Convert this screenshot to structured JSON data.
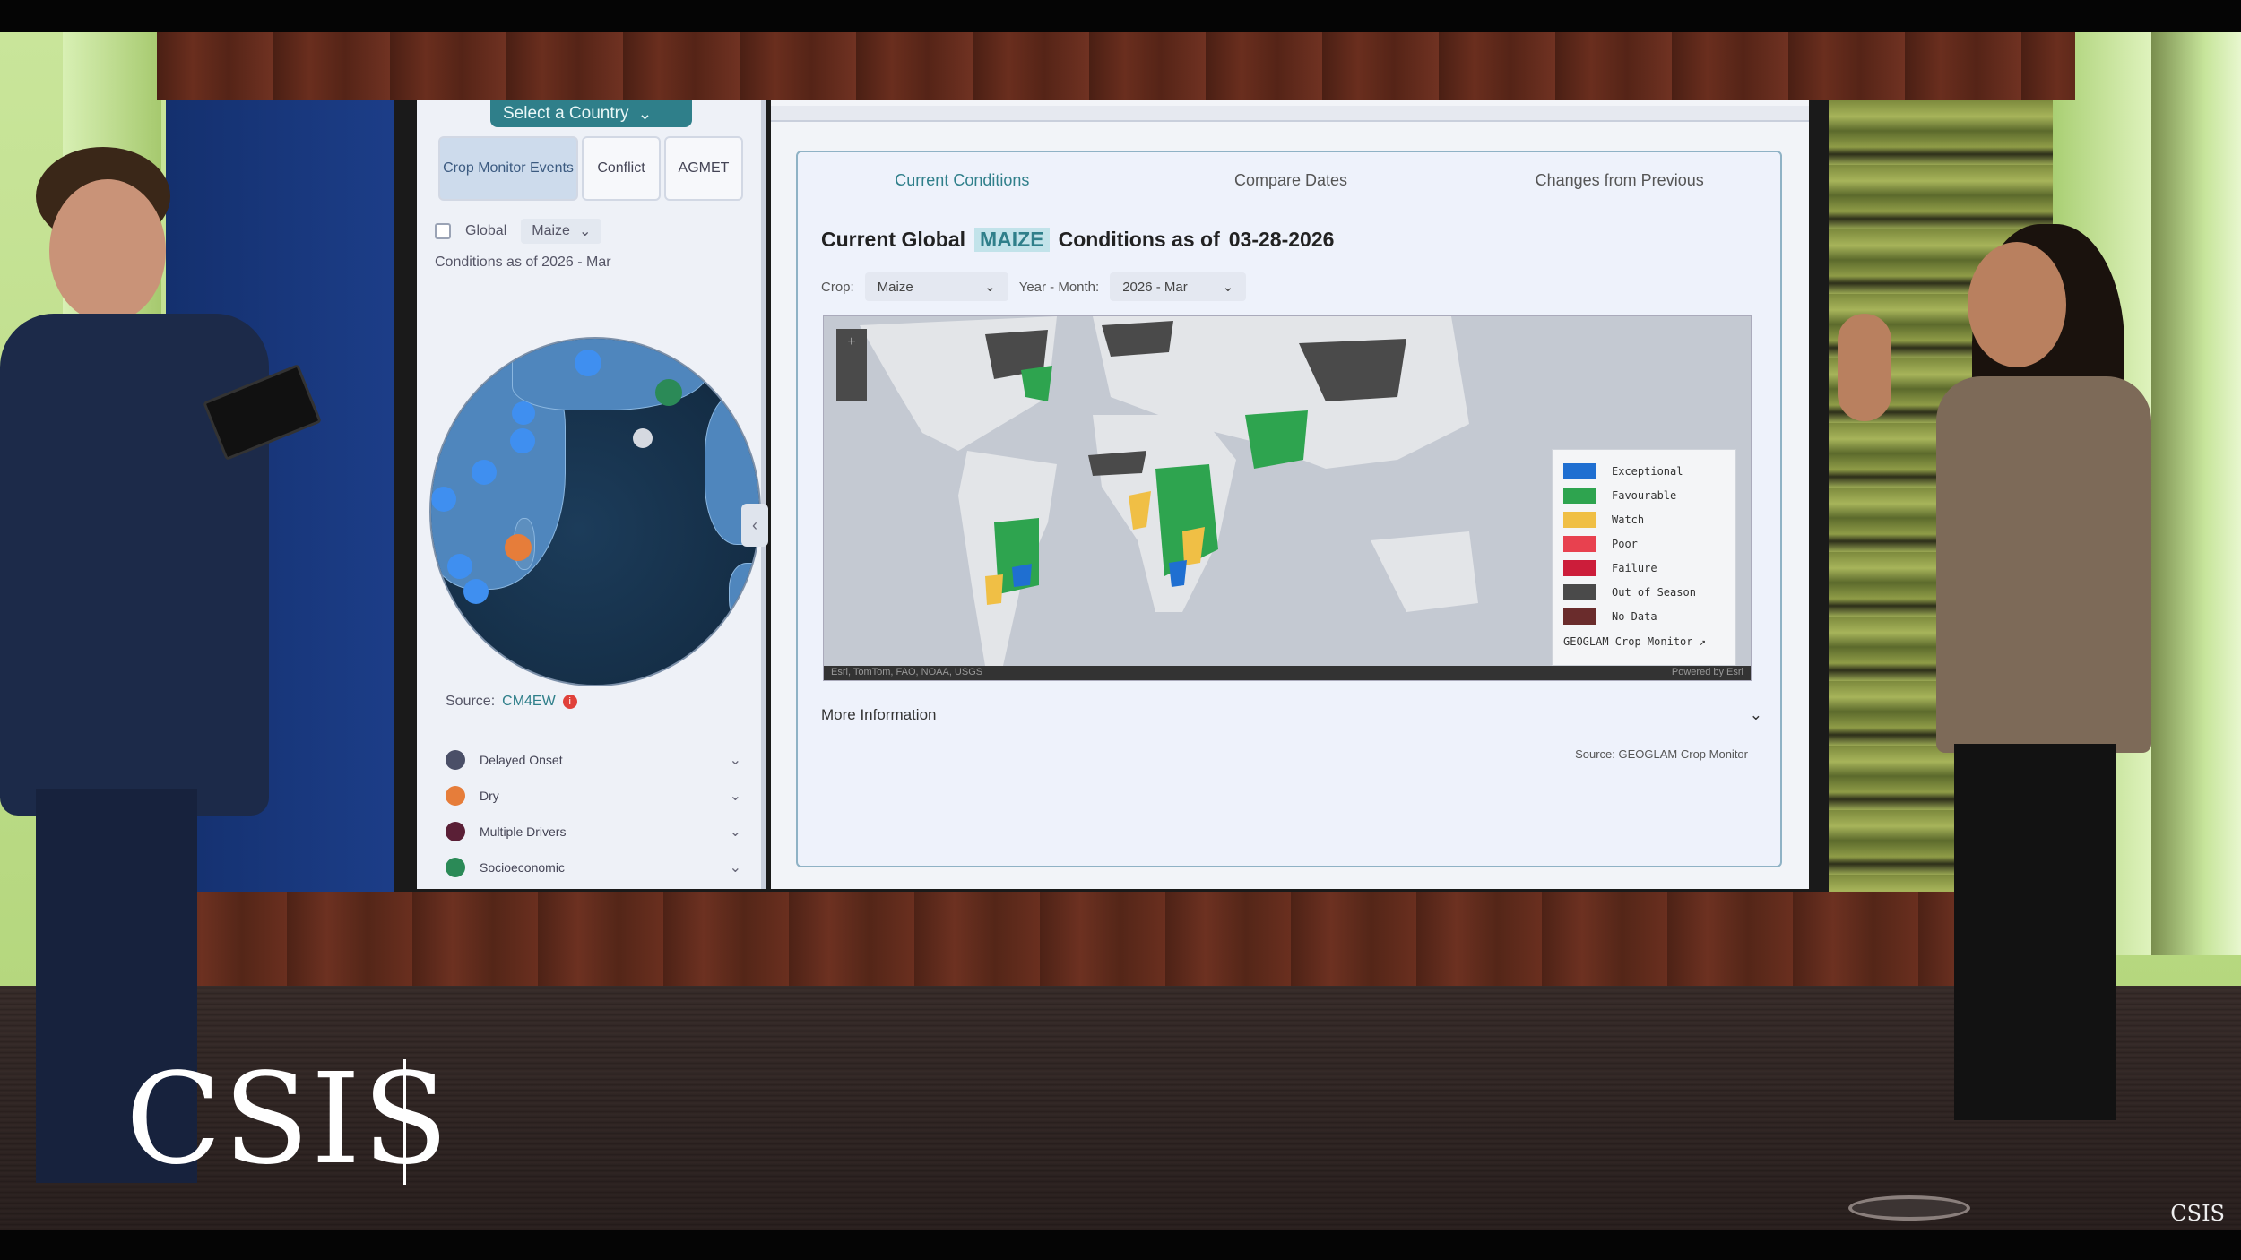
{
  "left_panel": {
    "country_select": "Select a Country",
    "tabs": [
      "Crop Monitor Events",
      "Conflict",
      "AGMET"
    ],
    "global_label": "Global",
    "crop_value": "Maize",
    "conditions_as_of": "Conditions as of 2026 - Mar",
    "source_label": "Source:",
    "source_value": "CM4EW",
    "events": [
      {
        "label": "Delayed Onset",
        "color": "#4a4f67"
      },
      {
        "label": "Dry",
        "color": "#e67d3a"
      },
      {
        "label": "Multiple Drivers",
        "color": "#5a1f36"
      },
      {
        "label": "Socioeconomic",
        "color": "#2b8a57"
      }
    ]
  },
  "main_panel": {
    "tabs": [
      "Current Conditions",
      "Compare Dates",
      "Changes from Previous"
    ],
    "title_prefix": "Current Global",
    "title_crop": "MAIZE",
    "title_middle": "Conditions as of",
    "title_date": "03-28-2026",
    "crop_label": "Crop:",
    "crop_value": "Maize",
    "year_month_label": "Year - Month:",
    "year_month_value": "2026 - Mar",
    "map_attribution": "Esri, TomTom, FAO, NOAA, USGS",
    "map_powered": "Powered by Esri",
    "legend": [
      {
        "label": "Exceptional",
        "color": "#1f6fd1"
      },
      {
        "label": "Favourable",
        "color": "#2ea44f"
      },
      {
        "label": "Watch",
        "color": "#f0bf45"
      },
      {
        "label": "Poor",
        "color": "#e8414f"
      },
      {
        "label": "Failure",
        "color": "#cc1d3a"
      },
      {
        "label": "Out of Season",
        "color": "#4a4a4a"
      },
      {
        "label": "No Data",
        "color": "#6a2c2c"
      }
    ],
    "legend_footer": "GEOGLAM Crop Monitor",
    "more_info": "More Information",
    "source_note": "Source: GEOGLAM Crop Monitor"
  },
  "watermark": {
    "logo": "CSIS",
    "corner": "CSIS"
  },
  "colors": {
    "accent": "#2f7f8a",
    "wall_green": "#c1e08f",
    "wood": "#5e2a1b"
  }
}
